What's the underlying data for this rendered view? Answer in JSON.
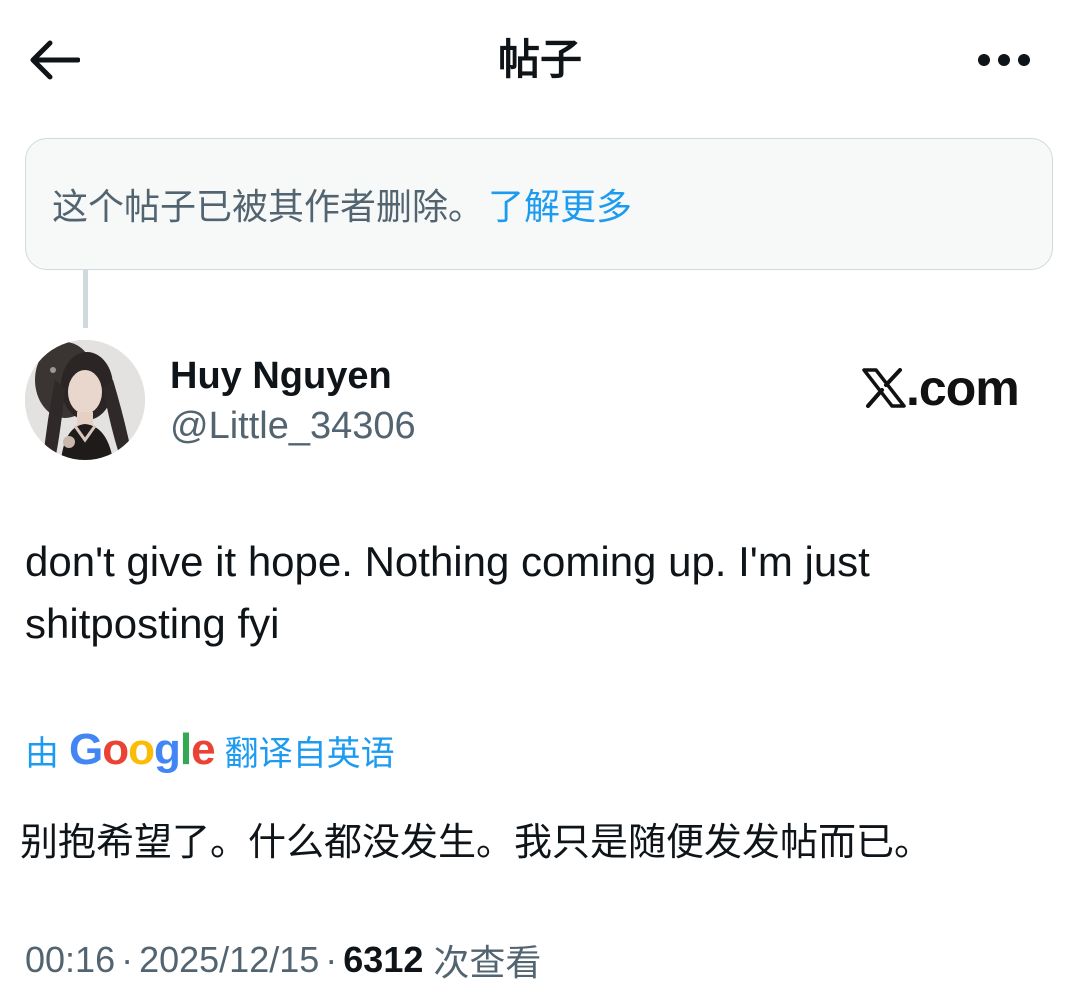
{
  "header": {
    "title": "帖子",
    "back_icon": "arrow-left-icon",
    "more_icon": "more-horizontal-icon"
  },
  "deleted_notice": {
    "text": "这个帖子已被其作者删除。",
    "link": "了解更多"
  },
  "author": {
    "display_name": "Huy Nguyen",
    "handle": "@Little_34306"
  },
  "watermark": {
    "text": "com"
  },
  "post": {
    "text": "don't give it hope. Nothing coming up. I'm just shitposting fyi"
  },
  "translation": {
    "prefix": "由",
    "provider": "Google",
    "suffix": "翻译自英语",
    "text": "别抱希望了。什么都没发生。我只是随便发发帖而已。"
  },
  "meta": {
    "time": "00:16",
    "date": "2025/12/15",
    "views": "6312",
    "views_label": "次查看",
    "separator": "·"
  },
  "colors": {
    "link_blue": "#1d9bf0",
    "secondary_text": "#536471",
    "primary_text": "#0f1419",
    "notice_bg": "#f7f9f9",
    "border": "#cfd9de"
  }
}
